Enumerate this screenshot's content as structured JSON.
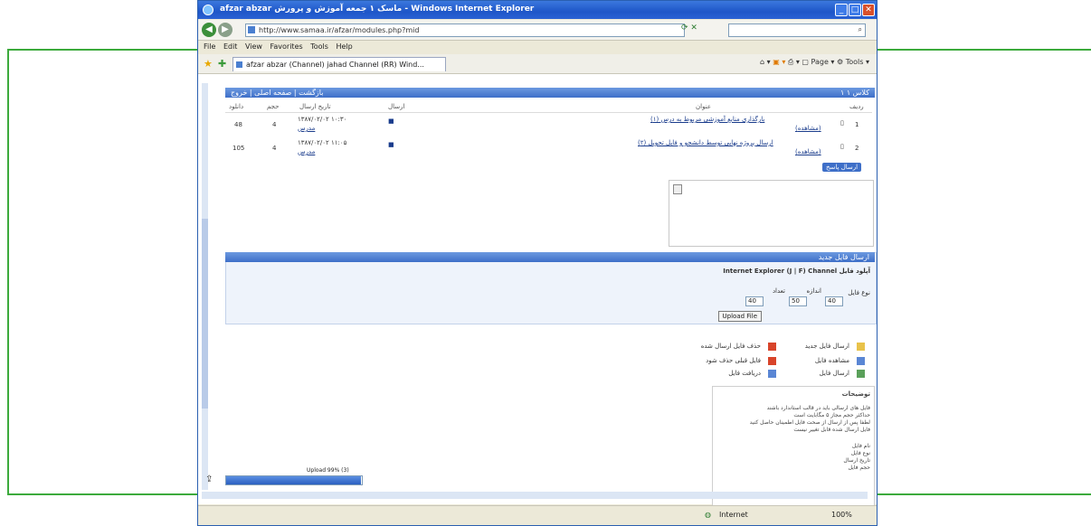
{
  "window": {
    "title": "afzar abzar ماسک ۱ جمعه آموزش و پرورش - Windows Internet Explorer",
    "controls": [
      "minimize",
      "maximize",
      "close"
    ]
  },
  "address_bar": {
    "url": "http://www.samaa.ir/afzar/modules.php?mid",
    "search_placeholder": ""
  },
  "menu": [
    "File",
    "Edit",
    "View",
    "Favorites",
    "Tools",
    "Help"
  ],
  "tab": {
    "title": "afzar abzar (Channel) jahad Channel (RR) Wind..."
  },
  "command_bar": {
    "page": "Page",
    "tools": "Tools"
  },
  "content": {
    "top_bar": "بازگشت  |  صفحه اصلی  |  خروج",
    "top_bar_right": "کلاس ۱ ۱",
    "table": {
      "headers": [
        "ردیف",
        "عنوان",
        "ارسال",
        "تاریخ ارسال",
        "حجم",
        "دانلود"
      ],
      "rows": [
        {
          "num": "1",
          "title": "بارگذاری منابع آموزشی مربوط به درس (۱)",
          "sub": "(مشاهده)",
          "date": "۱۳۸۷/۰۲/۰۲ ۱۰:۳۰",
          "sender": "مدرس",
          "size": "4",
          "dl": "48"
        },
        {
          "num": "2",
          "title": "ارسال پروژه نهایی توسط دانشجو و فایل تحویل (۲)",
          "sub": "(مشاهده)",
          "date": "۱۳۸۷/۰۲/۰۲ ۱۱:۰۵",
          "sender": "مدرس",
          "size": "4",
          "dl": "105"
        }
      ]
    },
    "send_button": "ارسال پاسخ",
    "form_bar": "ارسال فایل جدید",
    "form_title": "Internet Explorer (J | F) Channel آپلود فایل",
    "form_labels": {
      "type": "نوع فایل",
      "size": "اندازه",
      "count": "تعداد"
    },
    "form_values": {
      "v1": "40",
      "v2": "50",
      "v3": "40"
    },
    "upload_button": "Upload File",
    "attachments": [
      {
        "label": "ارسال فایل جدید",
        "note": "حذف فایل ارسال شده"
      },
      {
        "label": "مشاهده فایل",
        "note": "فایل قبلی حذف شود"
      },
      {
        "label": "ارسال فایل",
        "note": "دریافت فایل"
      }
    ],
    "info_title": "توضیحات",
    "info_lines": [
      "فایل های ارسالی باید در قالب استاندارد باشند",
      "حداکثر حجم مجاز ۵ مگابایت است",
      "لطفا پس از ارسال از صحت فایل اطمینان حاصل کنید",
      "فایل ارسال شده قابل تغییر نیست",
      "نام فایل",
      "نوع فایل",
      "تاریخ ارسال",
      "حجم فایل"
    ],
    "progress": {
      "label": "Upload 99% (3)",
      "percent": 99
    }
  },
  "status_bar": {
    "zone": "Internet",
    "zoom": "100%"
  },
  "colors": {
    "frame_green": "#3caa3c",
    "title_blue": "#1e56c8",
    "bar_blue": "#3e6fc8"
  }
}
